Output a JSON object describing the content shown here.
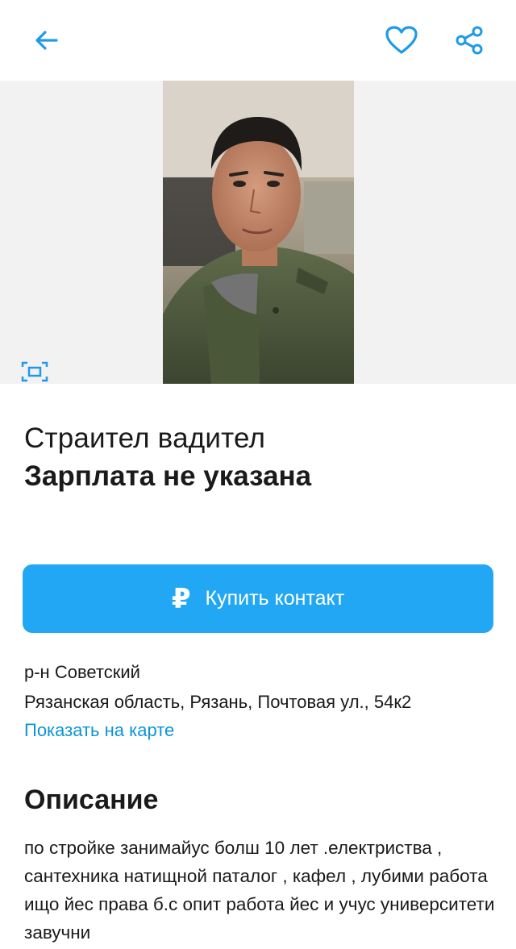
{
  "header": {
    "back_icon": "arrow-left-icon",
    "favorite_icon": "heart-icon",
    "share_icon": "share-icon",
    "accent_color": "#22a7f4"
  },
  "gallery": {
    "fullscreen_icon": "fullscreen-icon"
  },
  "listing": {
    "title": "Страител вадител",
    "salary": "Зарплата не указана"
  },
  "buy_button": {
    "currency_symbol": "₽",
    "label": "Купить контакт"
  },
  "location": {
    "district": "р-н Советский",
    "address": "Рязанская область, Рязань, Почтовая ул., 54к2",
    "map_link": "Показать на карте"
  },
  "description": {
    "heading": "Описание",
    "text": "по стройке занимайус болш 10 лет .електриства , сантехника натищной паталог , кафел , лубими работа ищо йес права б.с опит работа йес и учус университети завучни"
  }
}
